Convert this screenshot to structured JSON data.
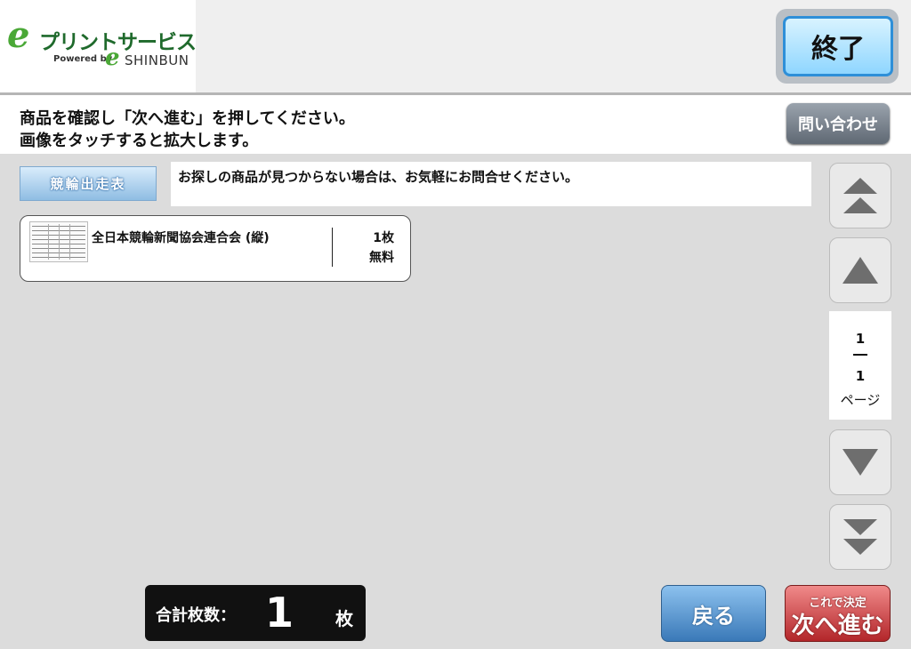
{
  "header": {
    "logo_mark": "e",
    "logo_title": "プリントサービス",
    "logo_powered": "Powered by",
    "logo_mark2": "e",
    "logo_shinbun": "SHINBUN",
    "end_button": "終了"
  },
  "instructions": {
    "line1": "商品を確認し「次へ進む」を押してください。",
    "line2": "画像をタッチすると拡大します。",
    "contact_button": "問い合わせ"
  },
  "category": {
    "tab_label": "競輪出走表",
    "notice": "お探しの商品が見つからない場合は、お気軽にお問合せください。"
  },
  "products": [
    {
      "name": "全日本競輪新聞協会連合会 (縦)",
      "quantity": "1枚",
      "price": "無料"
    }
  ],
  "pagination": {
    "current": "1",
    "total": "1",
    "label": "ページ"
  },
  "footer": {
    "total_label": "合計枚数：",
    "total_value": "1",
    "total_unit": "枚",
    "back_button": "戻る",
    "next_sub": "これで決定",
    "next_main": "次へ進む"
  },
  "colors": {
    "accent_green": "#4aa836",
    "end_button_border": "#2e8fd8",
    "back_button": "#3a79b8",
    "next_button": "#b3262a"
  }
}
